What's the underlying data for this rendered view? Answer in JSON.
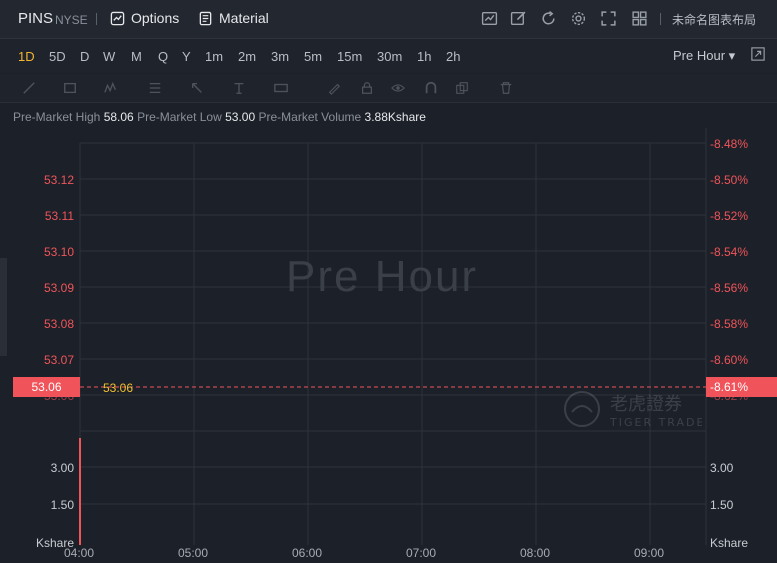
{
  "header": {
    "symbol": "PINS",
    "exchange": "NYSE",
    "options_label": "Options",
    "material_label": "Material",
    "chart_name": "未命名图表布局",
    "toolbar_icons": [
      "chart-icon",
      "edit-icon",
      "refresh-icon",
      "settings-icon",
      "fullscreen-icon",
      "grid-icon"
    ]
  },
  "timeframes": {
    "items": [
      "1D",
      "5D",
      "D",
      "W",
      "M",
      "Q",
      "Y",
      "1m",
      "2m",
      "3m",
      "5m",
      "15m",
      "30m",
      "1h",
      "2h"
    ],
    "active": "1D",
    "session_select": "Pre Hour ▾"
  },
  "drawing_tools": [
    "line-tool-icon",
    "rectangle-tool-icon",
    "pattern-tool-icon",
    "fib-tool-icon",
    "arrow-tool-icon",
    "text-tool-icon",
    "measure-tool-icon",
    "pen-icon",
    "lock-icon",
    "eye-icon",
    "magnet-icon",
    "copy-icon",
    "trash-icon"
  ],
  "info": {
    "high_label": "Pre-Market High",
    "high_value": "58.06",
    "low_label": "Pre-Market Low",
    "low_value": "53.00",
    "volume_label": "Pre-Market Volume",
    "volume_value": "3.88Kshare"
  },
  "chart": {
    "watermark": "Pre Hour",
    "brand_cn": "老虎證券",
    "brand_en": "TIGER TRADE",
    "current_price": "53.06",
    "current_pct": "-8.61%",
    "price_line_value": "53.06",
    "colors": {
      "down": "#f0545a",
      "price_line": "#f2c230",
      "grid": "#2e333c"
    }
  },
  "chart_data": {
    "type": "line",
    "y_ticks_left": [
      "53.12",
      "53.11",
      "53.10",
      "53.09",
      "53.08",
      "53.07"
    ],
    "y_ticks_right": [
      "-8.48%",
      "-8.50%",
      "-8.52%",
      "-8.54%",
      "-8.56%",
      "-8.58%",
      "-8.60%"
    ],
    "volume_ticks_left": [
      "3.00",
      "1.50",
      "Kshare"
    ],
    "volume_ticks_right": [
      "3.00",
      "1.50",
      "Kshare"
    ],
    "x_ticks": [
      "04:00",
      "05:00",
      "06:00",
      "07:00",
      "08:00",
      "09:00"
    ],
    "partial_left_label": "53.06",
    "partial_right_label": "-8.62%",
    "series": [
      {
        "x": [
          "04:00"
        ],
        "values": [
          53.06
        ]
      }
    ],
    "volume": [
      {
        "x": "04:00",
        "value": 3.88
      }
    ]
  }
}
